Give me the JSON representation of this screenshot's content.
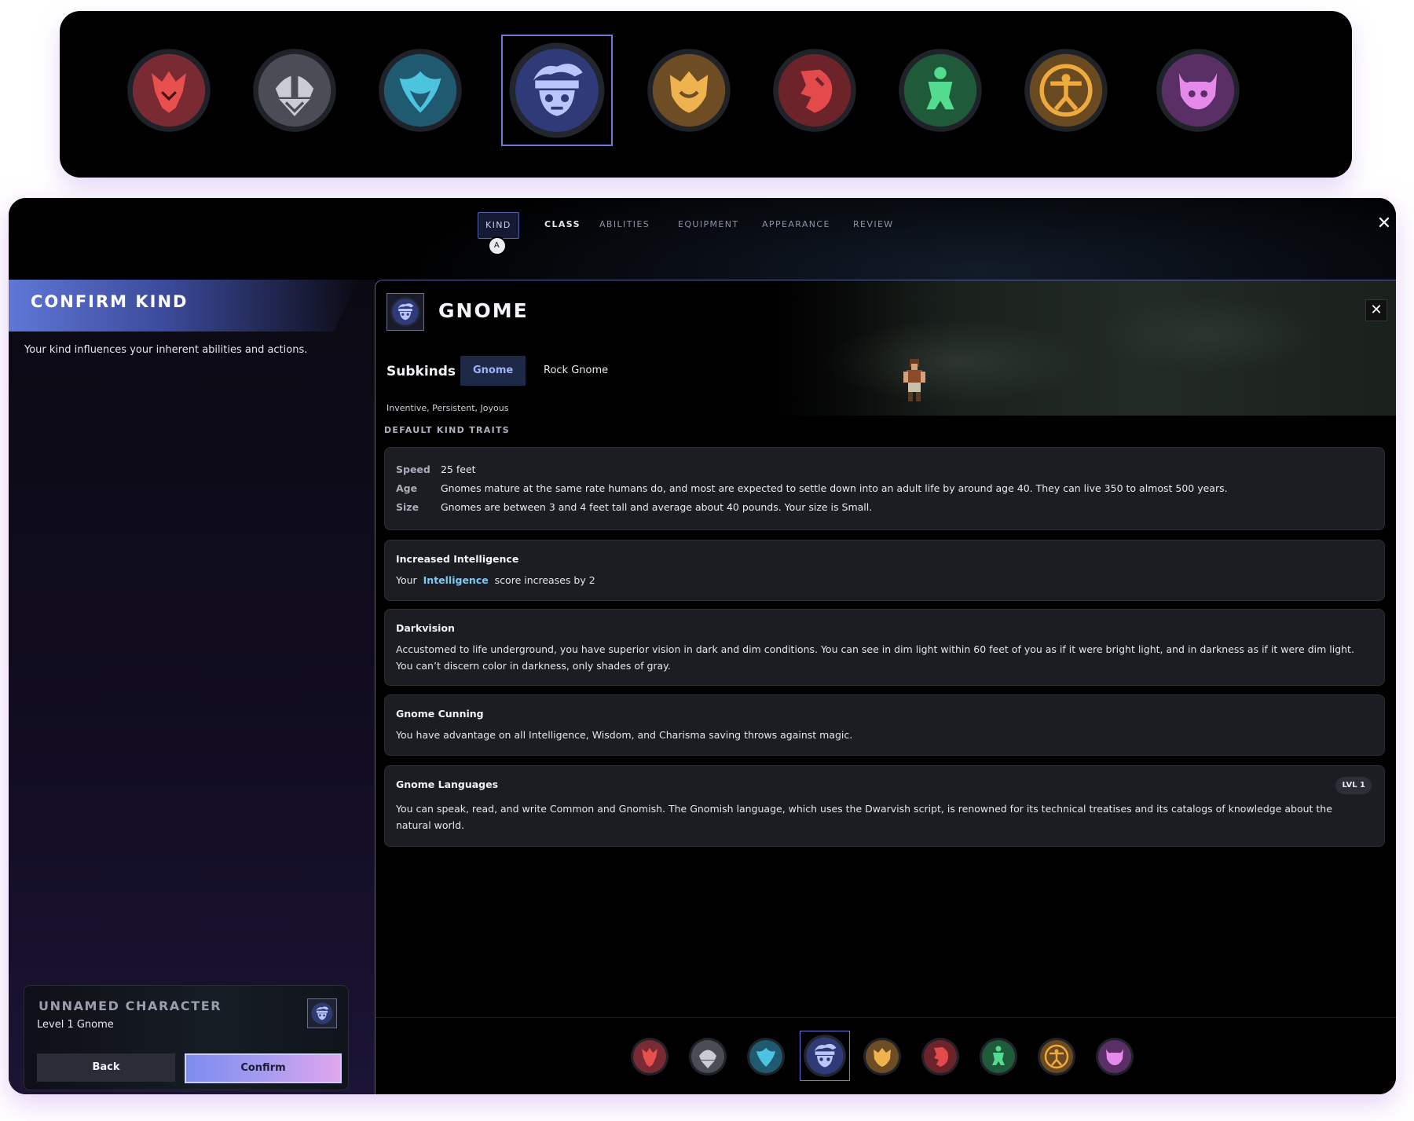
{
  "kinds": [
    {
      "id": "kind-1",
      "color": "#c9343e",
      "inner": "#7a2a33",
      "icon": "dragon-icon"
    },
    {
      "id": "kind-2",
      "color": "#b8bcc6",
      "inner": "#4a4d56",
      "icon": "dwarf-helm-icon"
    },
    {
      "id": "kind-3",
      "color": "#3cb6d6",
      "inner": "#1f5a70",
      "icon": "elf-leaf-icon"
    },
    {
      "id": "kind-4",
      "color": "#9fb3f5",
      "inner": "#2f3a78",
      "icon": "gnome-face-icon",
      "selected": true
    },
    {
      "id": "kind-5",
      "color": "#e7ae4a",
      "inner": "#6e4c24",
      "icon": "halfling-shield-icon"
    },
    {
      "id": "kind-6",
      "color": "#e0484a",
      "inner": "#6c2329",
      "icon": "half-orc-profile-icon"
    },
    {
      "id": "kind-7",
      "color": "#4fd38a",
      "inner": "#1f5b3a",
      "icon": "tiefling-figure-icon"
    },
    {
      "id": "kind-8",
      "color": "#e8a73d",
      "inner": "#6a4a20",
      "icon": "human-vitruvian-icon"
    },
    {
      "id": "kind-9",
      "color": "#e081e7",
      "inner": "#5a2f66",
      "icon": "tiefling-horns-icon"
    }
  ],
  "tabs": [
    {
      "label": "Kind",
      "badge": "a"
    },
    {
      "label": "Class"
    },
    {
      "label": "Abilities"
    },
    {
      "label": "Equipment"
    },
    {
      "label": "Appearance"
    },
    {
      "label": "Review"
    }
  ],
  "close_symbol": "✕",
  "left": {
    "title": "CONFIRM KIND",
    "description": "Your kind influences your inherent abilities and actions.",
    "character": {
      "name": "UNNAMED CHARACTER",
      "level": "Level 1 Gnome"
    },
    "back_label": "Back",
    "confirm_label": "Confirm"
  },
  "detail": {
    "title": "GNOME",
    "subkinds_label": "Subkinds",
    "subkinds": [
      {
        "label": "Gnome",
        "active": true
      },
      {
        "label": "Rock Gnome"
      }
    ],
    "traits_short": "Inventive, Persistent, Joyous",
    "section_label": "DEFAULT KIND TRAITS",
    "stats": [
      {
        "key": "Speed",
        "value": "25 feet"
      },
      {
        "key": "Age",
        "value": "Gnomes mature at the same rate humans do, and most are expected to settle down into an adult life by around age 40. They can live 350 to almost 500 years."
      },
      {
        "key": "Size",
        "value": "Gnomes are between 3 and 4 feet tall and average about 40 pounds. Your size is Small."
      }
    ],
    "traits": [
      {
        "title": "Increased Intelligence",
        "prefix": "Your",
        "highlight": "Intelligence",
        "suffix": "score increases by 2"
      },
      {
        "title": "Darkvision",
        "text": "Accustomed to life underground, you have superior vision in dark and dim conditions. You can see in dim light within 60 feet of you as if it were bright light, and in darkness as if it were dim light. You can’t discern color in darkness, only shades of gray."
      },
      {
        "title": "Gnome Cunning",
        "text": "You have advantage on all Intelligence, Wisdom, and Charisma saving throws against magic."
      },
      {
        "title": "Gnome Languages",
        "badge": "LVL 1",
        "text": "You can speak, read, and write Common and Gnomish. The Gnomish language, which uses the Dwarvish script, is renowned for its technical treatises and its catalogs of knowledge about the natural world."
      }
    ]
  }
}
